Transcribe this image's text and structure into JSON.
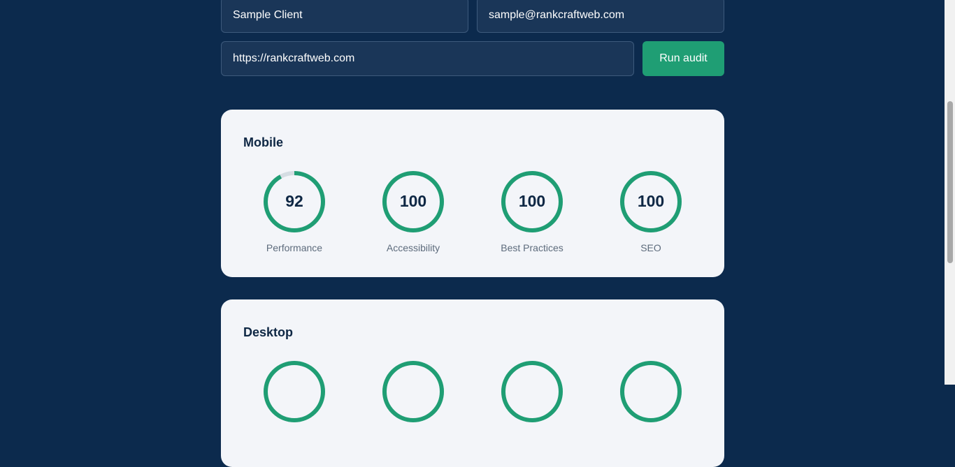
{
  "form": {
    "name_value": "Sample Client",
    "email_value": "sample@rankcraftweb.com",
    "url_value": "https://rankcraftweb.com",
    "run_label": "Run audit"
  },
  "mobile": {
    "title": "Mobile",
    "scores": [
      {
        "label": "Performance",
        "value": "92",
        "fraction": 0.92
      },
      {
        "label": "Accessibility",
        "value": "100",
        "fraction": 1
      },
      {
        "label": "Best Practices",
        "value": "100",
        "fraction": 1
      },
      {
        "label": "SEO",
        "value": "100",
        "fraction": 1
      }
    ]
  },
  "desktop": {
    "title": "Desktop",
    "scores": [
      {
        "fraction": 1
      },
      {
        "fraction": 1
      },
      {
        "fraction": 1
      },
      {
        "fraction": 1
      }
    ]
  },
  "colors": {
    "background": "#0c2a4d",
    "accent": "#1f9e74",
    "track": "#d5dde3",
    "card": "#f3f5f9"
  }
}
